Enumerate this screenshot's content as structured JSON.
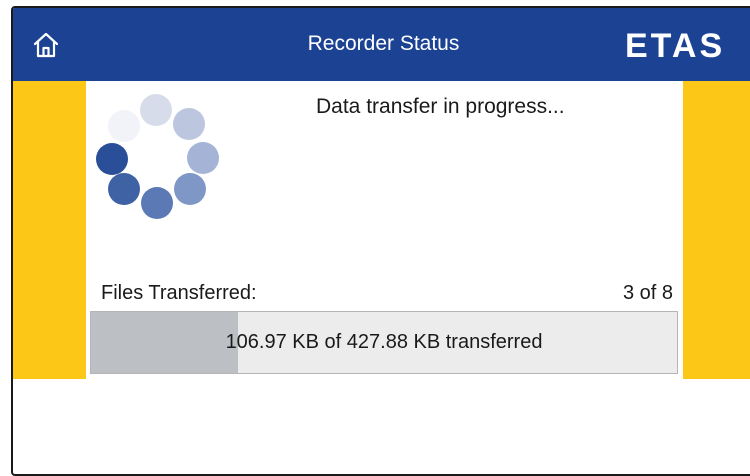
{
  "header": {
    "title": "Recorder Status",
    "brand": "ETAS",
    "home_icon": "home-icon",
    "background_color": "#1c4294"
  },
  "accent_color": "#fcc716",
  "status": {
    "message": "Data transfer in progress...",
    "spinner_icon": "loading-spinner-icon"
  },
  "files": {
    "label": "Files Transferred:",
    "count_text": "3 of 8",
    "transferred": 3,
    "total": 8
  },
  "progress": {
    "text": "106.97 KB of 427.88 KB transferred",
    "fraction": 0.25
  }
}
